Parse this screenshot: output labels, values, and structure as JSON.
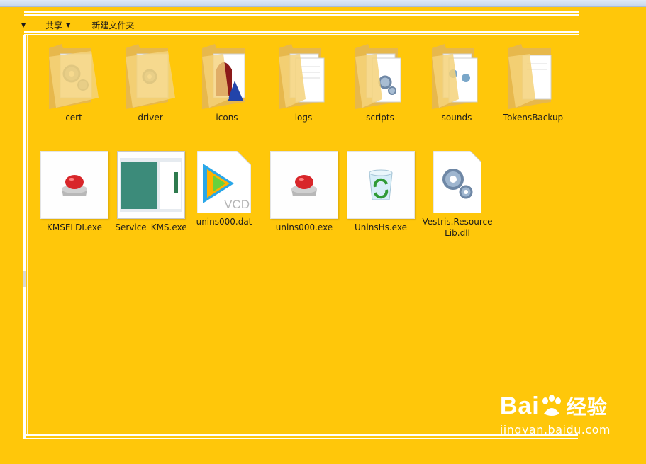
{
  "toolbar": {
    "share_label": "共享",
    "new_folder_label": "新建文件夹"
  },
  "folders": [
    {
      "label": "cert",
      "icon": "folder-gear-icon"
    },
    {
      "label": "driver",
      "icon": "folder-gear-icon"
    },
    {
      "label": "icons",
      "icon": "folder-image-icon"
    },
    {
      "label": "logs",
      "icon": "folder-documents-icon"
    },
    {
      "label": "scripts",
      "icon": "folder-gear-icon"
    },
    {
      "label": "sounds",
      "icon": "folder-audio-icon"
    },
    {
      "label": "TokensBackup",
      "icon": "folder-document-icon"
    }
  ],
  "files": [
    {
      "label": "KMSELDI.exe",
      "icon": "red-button-app-icon"
    },
    {
      "label": "Service_KMS.exe",
      "icon": "window-app-icon"
    },
    {
      "label": "unins000.dat",
      "icon": "video-player-file-icon"
    },
    {
      "label": "unins000.exe",
      "icon": "red-button-app-icon"
    },
    {
      "label": "UninsHs.exe",
      "icon": "recycle-bin-app-icon"
    },
    {
      "label": "Vestris.ResourceLib.dll",
      "icon": "dll-gear-file-icon"
    }
  ],
  "file_icon_text": {
    "vcd": "VCD"
  },
  "watermark": {
    "brand": "Bai",
    "brand_suffix": "经验",
    "url": "jingyan.baidu.com"
  },
  "colors": {
    "background": "#FFC70A",
    "folder": "#F5D27A",
    "red_button": "#D8262A"
  }
}
